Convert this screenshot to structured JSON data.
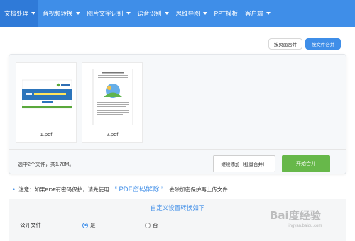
{
  "nav": {
    "items": [
      {
        "label": "文档处理",
        "active": true
      },
      {
        "label": "音视频转换"
      },
      {
        "label": "图片文字识别"
      },
      {
        "label": "语音识别"
      },
      {
        "label": "思维导图"
      },
      {
        "label": "PPT模板"
      },
      {
        "label": "客户端"
      }
    ]
  },
  "merge_modes": {
    "by_page": "按页面合并",
    "by_file": "按文件合并",
    "selected": "by_file"
  },
  "files": [
    {
      "name": "1.pdf"
    },
    {
      "name": "2.pdf"
    }
  ],
  "panel": {
    "summary": "选中2个文件，共1.78M。",
    "continue_label": "继续添加（批量合并）",
    "start_label": "开始合并"
  },
  "note": {
    "prefix": "注意：如果PDF有密码保护，请先使用",
    "link": "“ PDF密码解除 ”",
    "suffix": "去除加密保护再上传文件"
  },
  "settings": {
    "title": "自定义设置转换如下",
    "public_label": "公开文件",
    "yes_label": "是",
    "no_label": "否",
    "public_value": "是"
  },
  "colors": {
    "primary": "#3f8ee8",
    "nav_active": "#2f7ad8",
    "start_button": "#67b84a"
  },
  "watermark": {
    "text": "Bai度经验",
    "sub": "jingyan.baidu.com"
  }
}
